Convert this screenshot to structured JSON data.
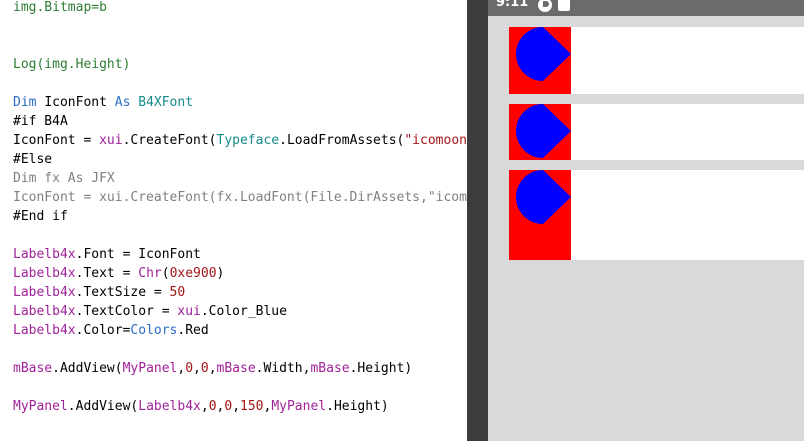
{
  "editor": {
    "lines": [
      [
        {
          "t": "img.Bitmap=b",
          "c": "tok-green"
        }
      ],
      [],
      [],
      [
        {
          "t": "Log(img.Height)",
          "c": "tok-green"
        }
      ],
      [],
      [
        {
          "t": "Dim ",
          "c": "tok-blue"
        },
        {
          "t": "IconFont ",
          "c": ""
        },
        {
          "t": "As ",
          "c": "tok-blue"
        },
        {
          "t": "B4XFont",
          "c": "tok-teal"
        }
      ],
      [
        {
          "t": "#if B4A",
          "c": ""
        }
      ],
      [
        {
          "t": "IconFont = ",
          "c": ""
        },
        {
          "t": "xui",
          "c": "tok-pink"
        },
        {
          "t": ".CreateFont(",
          "c": ""
        },
        {
          "t": "Typeface",
          "c": "tok-teal"
        },
        {
          "t": ".LoadFromAssets(",
          "c": ""
        },
        {
          "t": "\"icomoon",
          "c": "tok-str"
        }
      ],
      [
        {
          "t": "#Else",
          "c": ""
        }
      ],
      [
        {
          "t": "Dim fx As JFX",
          "c": "tok-gray"
        }
      ],
      [
        {
          "t": "IconFont = xui.CreateFont(fx.LoadFont(File.DirAssets,\"icomoon",
          "c": "tok-gray"
        }
      ],
      [
        {
          "t": "#End if",
          "c": ""
        }
      ],
      [],
      [
        {
          "t": "Labelb4x",
          "c": "tok-pink"
        },
        {
          "t": ".Font = IconFont",
          "c": ""
        }
      ],
      [
        {
          "t": "Labelb4x",
          "c": "tok-pink"
        },
        {
          "t": ".Text = ",
          "c": ""
        },
        {
          "t": "Chr",
          "c": "tok-pink"
        },
        {
          "t": "(",
          "c": ""
        },
        {
          "t": "0xe900",
          "c": "tok-red"
        },
        {
          "t": ")",
          "c": ""
        }
      ],
      [
        {
          "t": "Labelb4x",
          "c": "tok-pink"
        },
        {
          "t": ".TextSize = ",
          "c": ""
        },
        {
          "t": "50",
          "c": "tok-red"
        }
      ],
      [
        {
          "t": "Labelb4x",
          "c": "tok-pink"
        },
        {
          "t": ".TextColor = ",
          "c": ""
        },
        {
          "t": "xui",
          "c": "tok-pink"
        },
        {
          "t": ".Color_Blue",
          "c": ""
        }
      ],
      [
        {
          "t": "Labelb4x",
          "c": "tok-pink"
        },
        {
          "t": ".Color=",
          "c": ""
        },
        {
          "t": "Colors",
          "c": "tok-blue"
        },
        {
          "t": ".Red",
          "c": ""
        }
      ],
      [],
      [
        {
          "t": "mBase",
          "c": "tok-pink"
        },
        {
          "t": ".AddView(",
          "c": ""
        },
        {
          "t": "MyPanel",
          "c": "tok-pink"
        },
        {
          "t": ",",
          "c": ""
        },
        {
          "t": "0",
          "c": "tok-red"
        },
        {
          "t": ",",
          "c": ""
        },
        {
          "t": "0",
          "c": "tok-red"
        },
        {
          "t": ",",
          "c": ""
        },
        {
          "t": "mBase",
          "c": "tok-pink"
        },
        {
          "t": ".Width,",
          "c": ""
        },
        {
          "t": "mBase",
          "c": "tok-pink"
        },
        {
          "t": ".Height)",
          "c": ""
        }
      ],
      [],
      [
        {
          "t": "MyPanel",
          "c": "tok-pink"
        },
        {
          "t": ".AddView(",
          "c": ""
        },
        {
          "t": "Labelb4x",
          "c": "tok-pink"
        },
        {
          "t": ",",
          "c": ""
        },
        {
          "t": "0",
          "c": "tok-red"
        },
        {
          "t": ",",
          "c": ""
        },
        {
          "t": "0",
          "c": "tok-red"
        },
        {
          "t": ",",
          "c": ""
        },
        {
          "t": "150",
          "c": "tok-red"
        },
        {
          "t": ",",
          "c": ""
        },
        {
          "t": "MyPanel",
          "c": "tok-pink"
        },
        {
          "t": ".Height)",
          "c": ""
        }
      ]
    ]
  },
  "device": {
    "status_time": "9:11",
    "rows": [
      {
        "label_color": "#ff0000",
        "icon_color": "#0000ff"
      },
      {
        "label_color": "#ff0000",
        "icon_color": "#0000ff"
      },
      {
        "label_color": "#ff0000",
        "icon_color": "#0000ff"
      }
    ]
  }
}
